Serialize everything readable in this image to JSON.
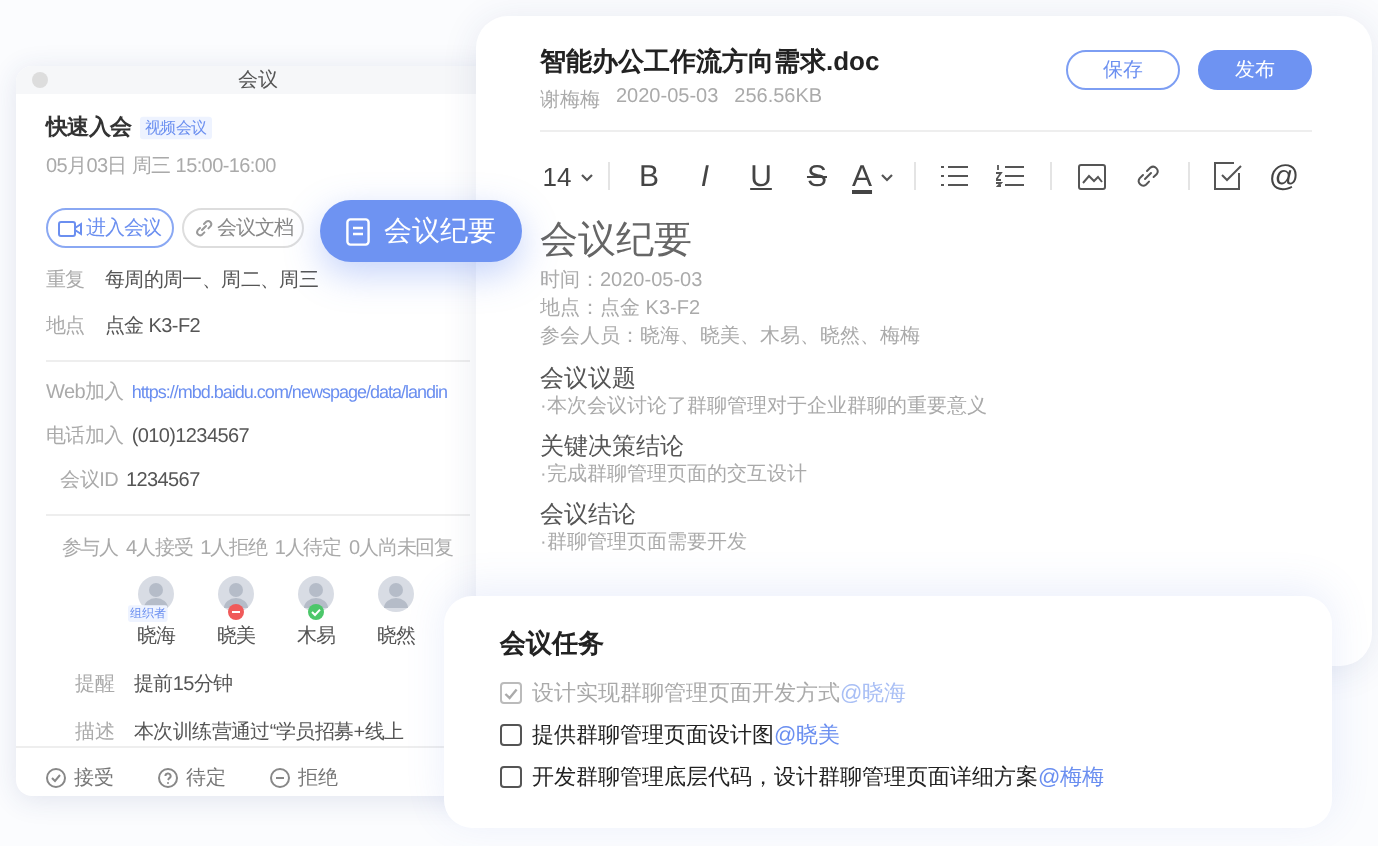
{
  "meeting": {
    "window_title": "会议",
    "title": "快速入会",
    "tag": "视频会议",
    "time": "05月03日 周三 15:00-16:00",
    "actions": [
      {
        "kind": "video",
        "label": "进入会议"
      },
      {
        "kind": "link",
        "label": "会议文档"
      }
    ],
    "details": [
      {
        "label": "重复",
        "value": "每周的周一、周二、周三"
      },
      {
        "label": "地点",
        "value": "点金 K3-F2"
      }
    ],
    "join": [
      {
        "label": "Web加入",
        "value": "https://mbd.baidu.com/newspage/data/landin",
        "kind": "link"
      },
      {
        "label": "电话加入",
        "value": "(010)1234567",
        "kind": "text"
      },
      {
        "label": "会议ID",
        "value": "1234567",
        "kind": "text"
      }
    ],
    "participants": {
      "label": "参与人",
      "stats": [
        "4人接受",
        "1人拒绝",
        "1人待定",
        "0人尚未回复"
      ],
      "people": [
        {
          "name": "晓海",
          "badge": "组织者",
          "accepted": false,
          "declined": false
        },
        {
          "name": "晓美",
          "accepted": false,
          "declined": true
        },
        {
          "name": "木易",
          "accepted": true,
          "declined": false
        },
        {
          "name": "晓然",
          "accepted": false,
          "declined": false
        }
      ]
    },
    "extra": [
      {
        "label": "提醒",
        "value": "提前15分钟"
      },
      {
        "label": "描述",
        "value": "本次训练营通过“学员招募+线上"
      }
    ],
    "responses": [
      {
        "kind": "accept",
        "label": "接受"
      },
      {
        "kind": "tentative",
        "label": "待定"
      },
      {
        "kind": "decline",
        "label": "拒绝"
      }
    ]
  },
  "floating_button": {
    "label": "会议纪要"
  },
  "document": {
    "title": "智能办公工作流方向需求.doc",
    "author": "谢梅梅",
    "date": "2020-05-03",
    "size": "256.56KB",
    "buttons": [
      {
        "kind": "outline",
        "label": "保存"
      },
      {
        "kind": "primary",
        "label": "发布"
      }
    ],
    "toolbar": [
      {
        "kind": "font-size",
        "label": "14"
      },
      {
        "kind": "separator"
      },
      {
        "kind": "bold",
        "label": "B"
      },
      {
        "kind": "italic",
        "label": "I"
      },
      {
        "kind": "underline",
        "label": "U"
      },
      {
        "kind": "strike",
        "label": "S"
      },
      {
        "kind": "color",
        "label": "A"
      },
      {
        "kind": "separator"
      },
      {
        "kind": "bullets"
      },
      {
        "kind": "numbers"
      },
      {
        "kind": "separator"
      },
      {
        "kind": "image"
      },
      {
        "kind": "link"
      },
      {
        "kind": "separator"
      },
      {
        "kind": "checkbox"
      },
      {
        "kind": "mention",
        "label": "@"
      }
    ],
    "body": {
      "heading": "会议纪要",
      "meta": [
        "时间：2020-05-03",
        "地点：点金 K3-F2",
        "参会人员：晓海、晓美、木易、晓然、梅梅"
      ],
      "sections": [
        {
          "title": "会议议题",
          "items": [
            "·本次会议讨论了群聊管理对于企业群聊的重要意义"
          ]
        },
        {
          "title": "关键决策结论",
          "items": [
            "·完成群聊管理页面的交互设计"
          ]
        },
        {
          "title": "会议结论",
          "items": [
            "·群聊管理页面需要开发"
          ]
        }
      ]
    }
  },
  "tasks": {
    "title": "会议任务",
    "items": [
      {
        "text": "设计实现群聊管理页面开发方式",
        "mention": "@晓海",
        "checked": true
      },
      {
        "text": "提供群聊管理页面设计图",
        "mention": "@晓美",
        "checked": false
      },
      {
        "text": "开发群聊管理底层代码，设计群聊管理页面详细方案",
        "mention": "@梅梅",
        "checked": false
      }
    ]
  }
}
